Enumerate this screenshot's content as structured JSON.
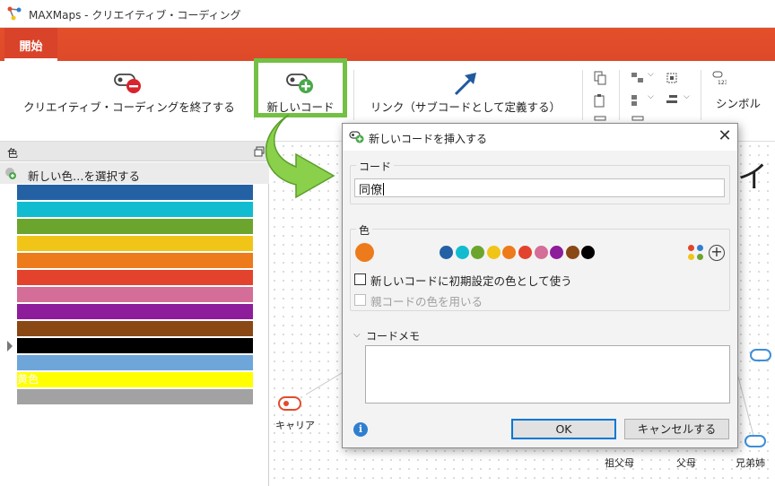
{
  "window": {
    "title": "MAXMaps - クリエイティブ・コーディング"
  },
  "ribbon": {
    "active_tab": "開始",
    "end_label": "クリエイティブ・コーディングを終了する",
    "new_code_label": "新しいコード",
    "link_label": "リンク（サブコードとして定義する）",
    "symbol_label": "シンボル",
    "highlight_color": "#74c044"
  },
  "colors_panel": {
    "title": "色",
    "select_label": "新しい色…を選択する",
    "swatches": [
      {
        "color": "#2461a4",
        "label": ""
      },
      {
        "color": "#11bcd0",
        "label": ""
      },
      {
        "color": "#6ca52d",
        "label": ""
      },
      {
        "color": "#f1c418",
        "label": ""
      },
      {
        "color": "#ed7a1b",
        "label": ""
      },
      {
        "color": "#e3432c",
        "label": ""
      },
      {
        "color": "#d46d98",
        "label": ""
      },
      {
        "color": "#8e1d9b",
        "label": ""
      },
      {
        "color": "#8a4815",
        "label": ""
      },
      {
        "color": "#000000",
        "label": ""
      },
      {
        "color": "#6ea6da",
        "label": ""
      },
      {
        "color": "#ffff00",
        "label": "黄色"
      },
      {
        "color": "#a2a2a2",
        "label": ""
      }
    ]
  },
  "canvas": {
    "big_glyph": "イ",
    "nodes": {
      "career": "キャリア",
      "grandparents": "祖父母",
      "parents": "父母",
      "siblings": "兄弟姉"
    }
  },
  "dialog": {
    "title": "新しいコードを挿入する",
    "code_group_label": "コード",
    "code_value": "同僚",
    "color_group_label": "色",
    "current_color": "#ed7a1b",
    "palette": [
      "#2461a4",
      "#11bcd0",
      "#6ca52d",
      "#f1c418",
      "#ed7a1b",
      "#e3432c",
      "#d46d98",
      "#8e1d9b",
      "#8a4815",
      "#000000"
    ],
    "default_color_label": "新しいコードに初期設定の色として使う",
    "default_color_checked": false,
    "parent_color_label": "親コードの色を用いる",
    "parent_color_checked": false,
    "memo_label": "コードメモ",
    "memo_value": "",
    "ok_label": "OK",
    "cancel_label": "キャンセルする"
  }
}
